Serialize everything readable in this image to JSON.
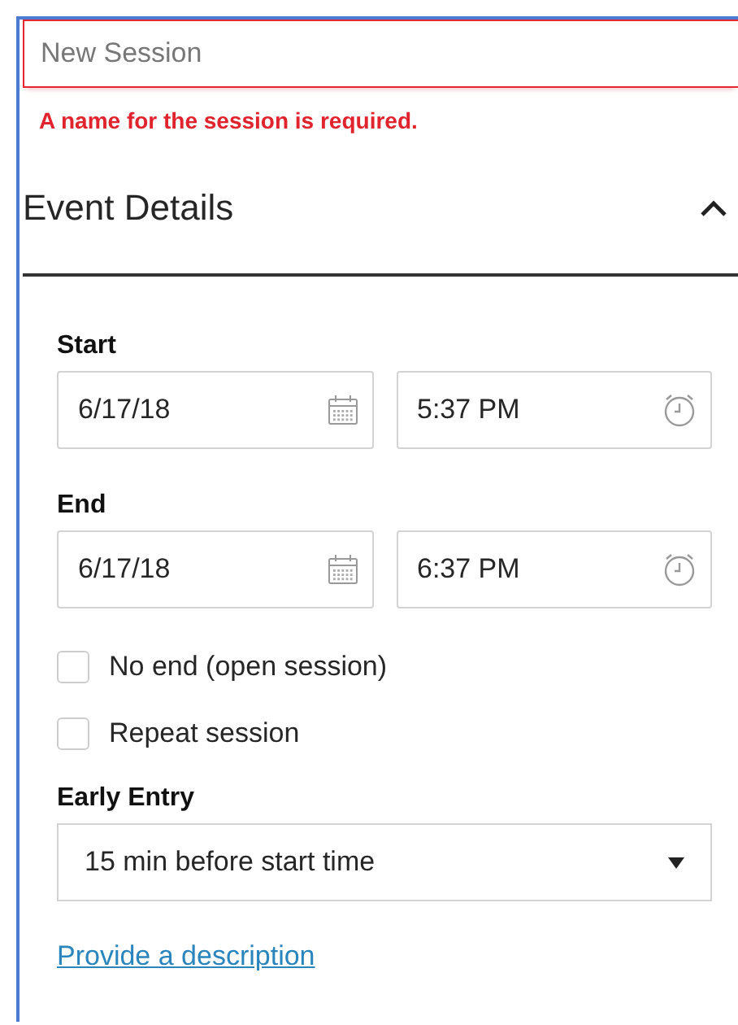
{
  "session_name": {
    "placeholder": "New Session",
    "invalid": true,
    "error": "A name for the session is required."
  },
  "section": {
    "title": "Event Details",
    "expanded": true
  },
  "start": {
    "label": "Start",
    "date": "6/17/18",
    "time": "5:37 PM"
  },
  "end": {
    "label": "End",
    "date": "6/17/18",
    "time": "6:37 PM"
  },
  "options": [
    {
      "label": "No end (open session)",
      "checked": false
    },
    {
      "label": "Repeat session",
      "checked": false
    }
  ],
  "early_entry": {
    "label": "Early Entry",
    "value": "15 min before start time"
  },
  "description_link": "Provide a description"
}
